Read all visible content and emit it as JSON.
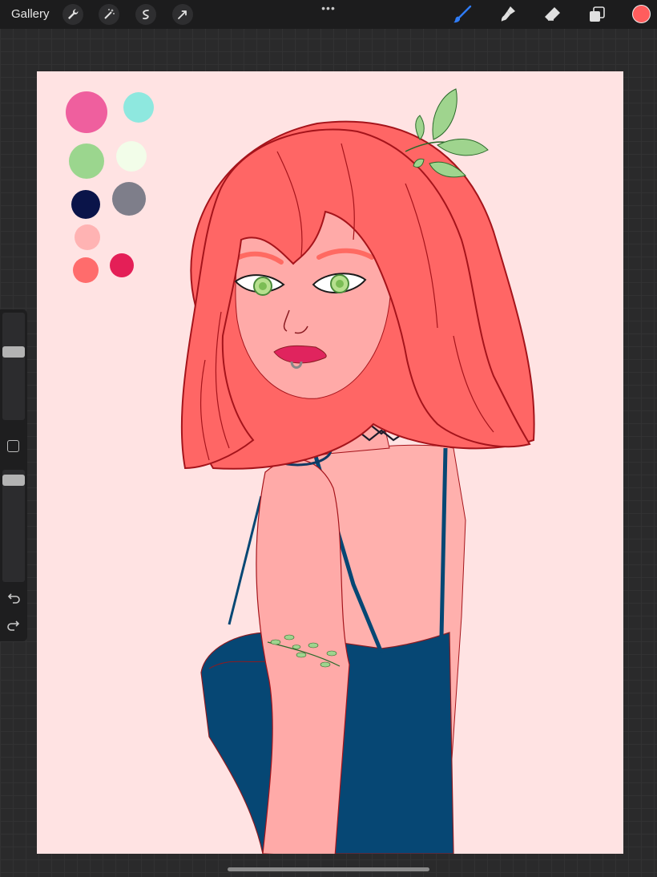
{
  "toolbar": {
    "gallery_label": "Gallery",
    "left_tools": [
      "wrench-icon",
      "magic-wand-icon",
      "selection-icon",
      "transform-arrow-icon"
    ],
    "right_tools": [
      "brush-icon",
      "smudge-icon",
      "eraser-icon",
      "layers-icon"
    ],
    "more_label": "•••",
    "active_tool": "brush",
    "accent_color": "#2f7cf6"
  },
  "current_color": "#ff5d5d",
  "canvas": {
    "background": "#ffe3e3",
    "palette_swatches": [
      "#ef5f9e",
      "#8ee8df",
      "#9bd68e",
      "#f2fde9",
      "#0a1449",
      "#7e7e8a",
      "#ffb3b3",
      "#ff6c6c",
      "#e41f57"
    ]
  },
  "sidebar": {
    "brush_size": 0.65,
    "opacity": 0.95,
    "icons": [
      "modify-square-icon",
      "undo-icon",
      "redo-icon"
    ]
  }
}
